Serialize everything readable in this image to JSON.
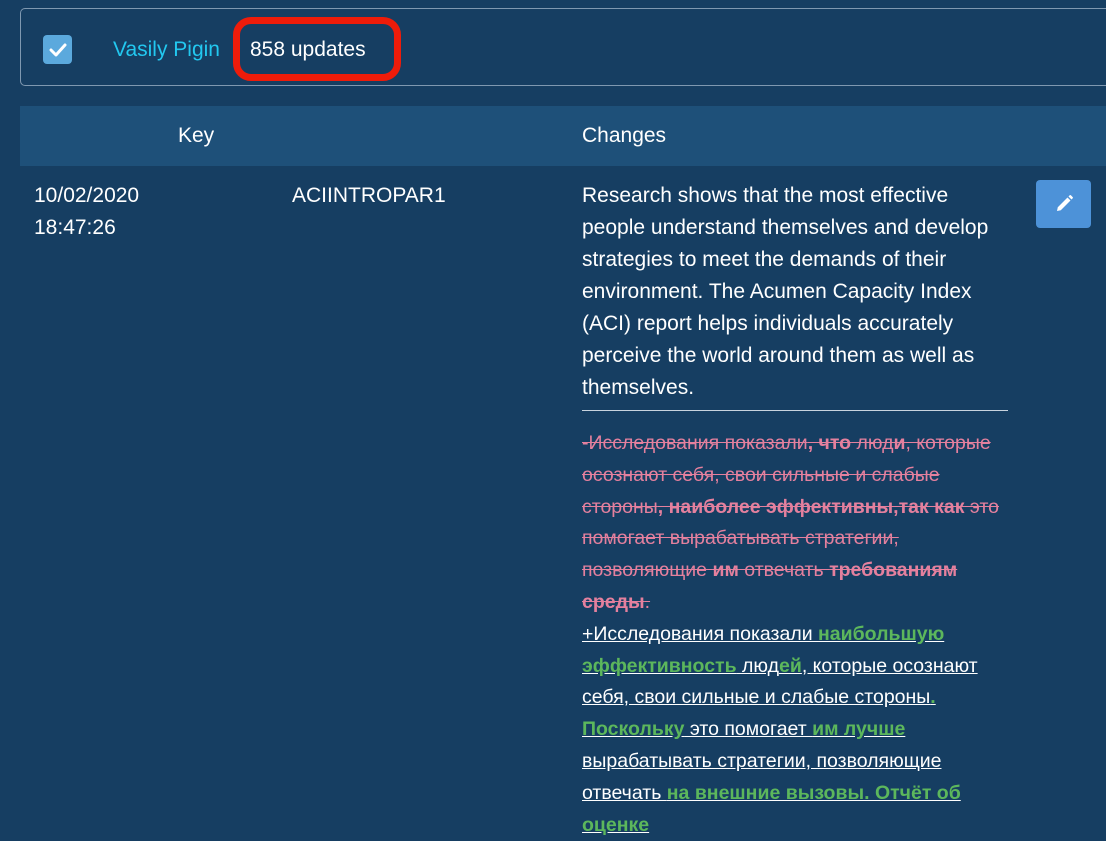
{
  "filter": {
    "checked": true,
    "author": "Vasily Pigin",
    "updates": "858 updates"
  },
  "table": {
    "headers": {
      "key": "Key",
      "changes": "Changes"
    },
    "row": {
      "date": "10/02/2020",
      "time": "18:47:26",
      "key": "ACIINTROPAR1",
      "english": "Research shows that the most effective people understand themselves and develop strategies to meet the demands of their environment. The Acumen Capacity Index (ACI) report helps individuals accurately perceive the world around them as well as themselves.",
      "diff_removed": [
        "-Исследования показали",
        ", что",
        " люд",
        "и",
        ", которые осознают себя, свои сильные и слабые стороны",
        ", наиболее эффективны,так как",
        " это помогает вырабатывать стратегии, позволяющие ",
        "им",
        " отвечать ",
        "требованиям среды",
        "."
      ],
      "diff_added": [
        "+Исследования показали ",
        "наибольшую эффективность",
        " люд",
        "ей",
        ", которые осознают себя, свои сильные и слабые стороны",
        ". Поскольку",
        " это помогает ",
        "им лучше",
        " вырабатывать стратегии, позволяющие отвечать ",
        "на внешние вызовы. Отчёт об оценке"
      ]
    }
  },
  "colors": {
    "background": "#163e62",
    "header": "#1e5079",
    "link": "#22c8f0",
    "removed": "#e4809e",
    "added_highlight": "#5cb75c",
    "annotation": "#ee1c0a",
    "edit_button": "#4d92d8"
  },
  "icons": {
    "checkbox": "check-icon",
    "edit": "pencil-icon"
  }
}
